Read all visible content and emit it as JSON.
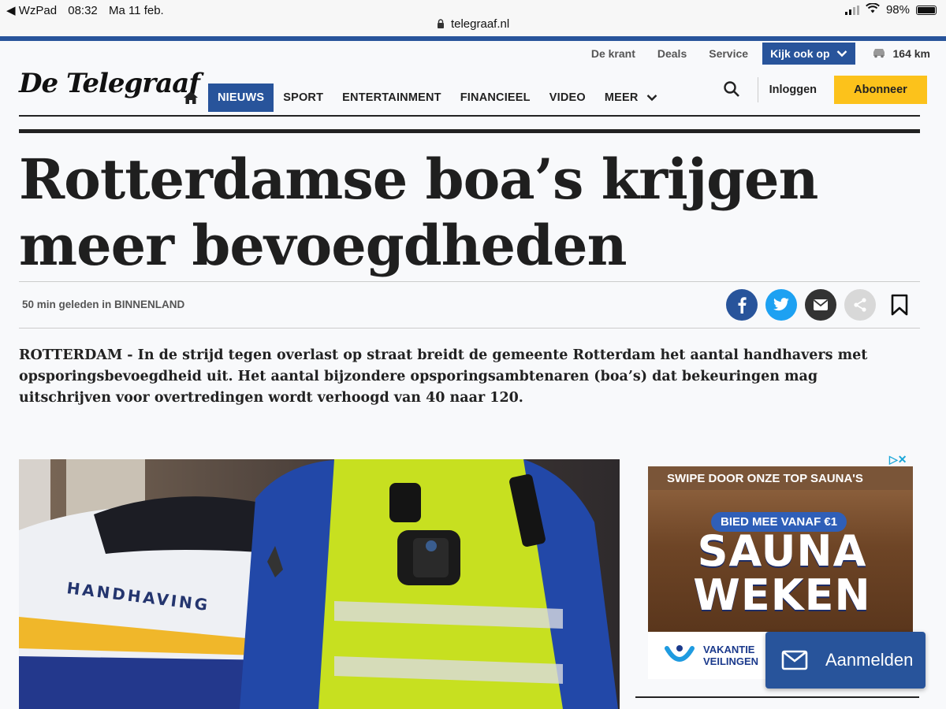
{
  "status_bar": {
    "back_app": "◀ WzPad",
    "time": "08:32",
    "date": "Ma 11 feb.",
    "url": "telegraaf.nl",
    "battery": "98%",
    "battery_level": 0.98
  },
  "utility_nav": {
    "items": [
      "De krant",
      "Deals",
      "Service"
    ],
    "kijk_ook_op": "Kijk ook op",
    "traffic_km": "164 km"
  },
  "logo": "De Telegraaf",
  "main_nav": {
    "items": [
      "NIEUWS",
      "SPORT",
      "ENTERTAINMENT",
      "FINANCIEEL",
      "VIDEO",
      "MEER"
    ],
    "active": "NIEUWS",
    "login": "Inloggen",
    "subscribe": "Abonneer"
  },
  "article": {
    "headline": "Rotterdamse boa’s krijgen meer bevoegdheden",
    "meta": "50 min geleden in BINNENLAND",
    "intro": "ROTTERDAM - In de strijd tegen overlast op straat breidt de gemeente Rotterdam het aantal handhavers met opsporingsbevoegdheid uit. Het aantal bijzondere opsporingsambtenaren (boa’s) dat bekeuringen mag uitschrijven voor overtredingen wordt verhoogd van 40 naar 120.",
    "photo_text": "HANDHAVING"
  },
  "ad": {
    "top_text": "SWIPE DOOR ONZE TOP SAUNA'S",
    "pill": "BIED MEE VANAF €1",
    "title_line1": "SAUNA",
    "title_line2": "WEKEN",
    "brand_line1": "VAKANTIE",
    "brand_line2": "VEILINGEN"
  },
  "newsletter_button": "Aanmelden",
  "colors": {
    "brand_blue": "#28549b",
    "subscribe_yellow": "#fcc21b",
    "twitter": "#1da1f2"
  }
}
